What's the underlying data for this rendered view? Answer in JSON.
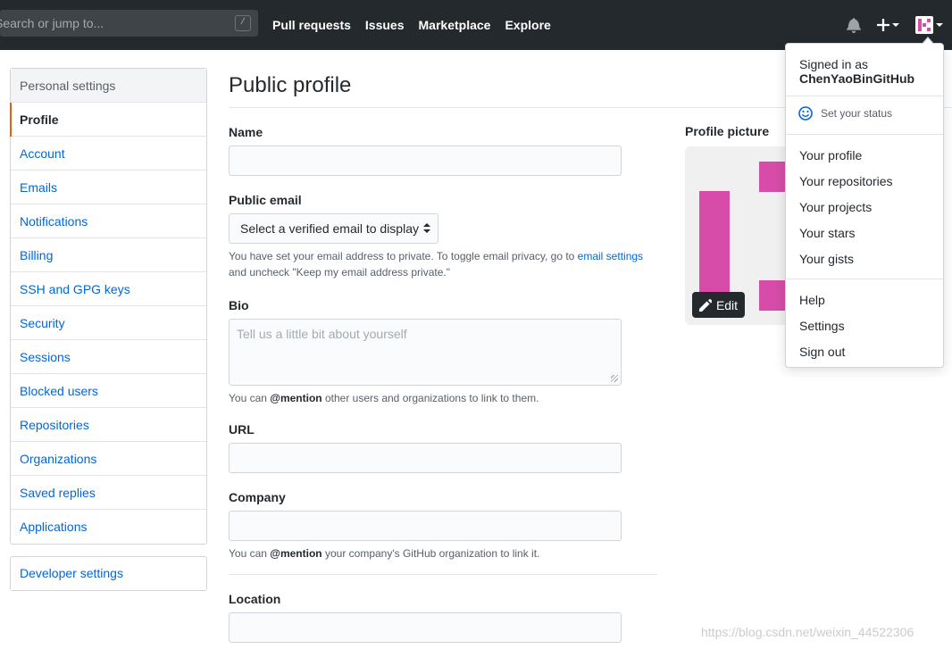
{
  "header": {
    "search_placeholder": "Search or jump to...",
    "search_hint": "/",
    "nav": [
      "Pull requests",
      "Issues",
      "Marketplace",
      "Explore"
    ]
  },
  "sidebar": {
    "heading": "Personal settings",
    "items": [
      "Profile",
      "Account",
      "Emails",
      "Notifications",
      "Billing",
      "SSH and GPG keys",
      "Security",
      "Sessions",
      "Blocked users",
      "Repositories",
      "Organizations",
      "Saved replies",
      "Applications"
    ],
    "selected": "Profile",
    "developer_settings": "Developer settings"
  },
  "main": {
    "title": "Public profile",
    "name_label": "Name",
    "name_value": "",
    "email_label": "Public email",
    "email_select": "Select a verified email to display",
    "email_note_1": "You have set your email address to private. To toggle email privacy, go to ",
    "email_note_link": "email settings",
    "email_note_2": "and uncheck \"Keep my email address private.\"",
    "bio_label": "Bio",
    "bio_placeholder": "Tell us a little bit about yourself",
    "bio_note_pre": "You can ",
    "bio_note_mention": "@mention",
    "bio_note_post": " other users and organizations to link to them.",
    "url_label": "URL",
    "company_label": "Company",
    "company_note_pre": "You can ",
    "company_note_mention": "@mention",
    "company_note_post": " your company's GitHub organization to link it.",
    "location_label": "Location"
  },
  "profile_picture": {
    "label": "Profile picture",
    "edit_label": "Edit",
    "accent": "#d64ca8"
  },
  "dropdown": {
    "signed_in_as": "Signed in as",
    "username": "ChenYaoBinGitHub",
    "set_status": "Set your status",
    "group1": [
      "Your profile",
      "Your repositories",
      "Your projects",
      "Your stars",
      "Your gists"
    ],
    "group2": [
      "Help",
      "Settings",
      "Sign out"
    ]
  },
  "watermark": "https://blog.csdn.net/weixin_44522306"
}
